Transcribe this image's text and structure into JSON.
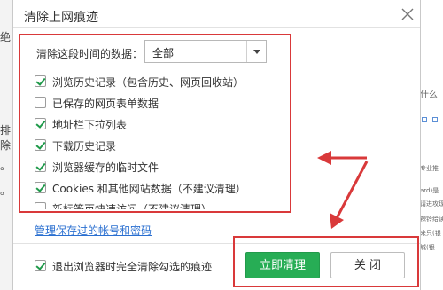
{
  "background": {
    "left_fragments": [
      "绝",
      "排除",
      "。",
      "。"
    ],
    "right_fragments": [
      "什么",
      "专业推",
      "ard)是",
      "请进攻现",
      "辣铃给读",
      "来只(银",
      "城(银"
    ]
  },
  "dialog": {
    "title": "清除上网痕迹",
    "close_icon": "close-icon",
    "time_range": {
      "label": "清除这段时间的数据：",
      "selected": "全部"
    },
    "options": [
      {
        "label": "浏览历史记录（包含历史、网页回收站）",
        "checked": true
      },
      {
        "label": "已保存的网页表单数据",
        "checked": false
      },
      {
        "label": "地址栏下拉列表",
        "checked": true
      },
      {
        "label": "下载历史记录",
        "checked": true
      },
      {
        "label": "浏览器缓存的临时文件",
        "checked": true
      },
      {
        "label": "Cookies 和其他网站数据（不建议清理）",
        "checked": true
      },
      {
        "label": "新标签页快速访问（不建议清理）",
        "checked": false
      }
    ],
    "manage_link": "管理保存过的帐号和密码",
    "exit_option": {
      "label": "退出浏览器时完全清除勾选的痕迹",
      "checked": true
    },
    "buttons": {
      "primary": "立即清理",
      "secondary": "关 闭"
    }
  },
  "colors": {
    "annotation_red": "#d9393a",
    "primary_green": "#27ad55",
    "link_blue": "#2a6fd0"
  }
}
